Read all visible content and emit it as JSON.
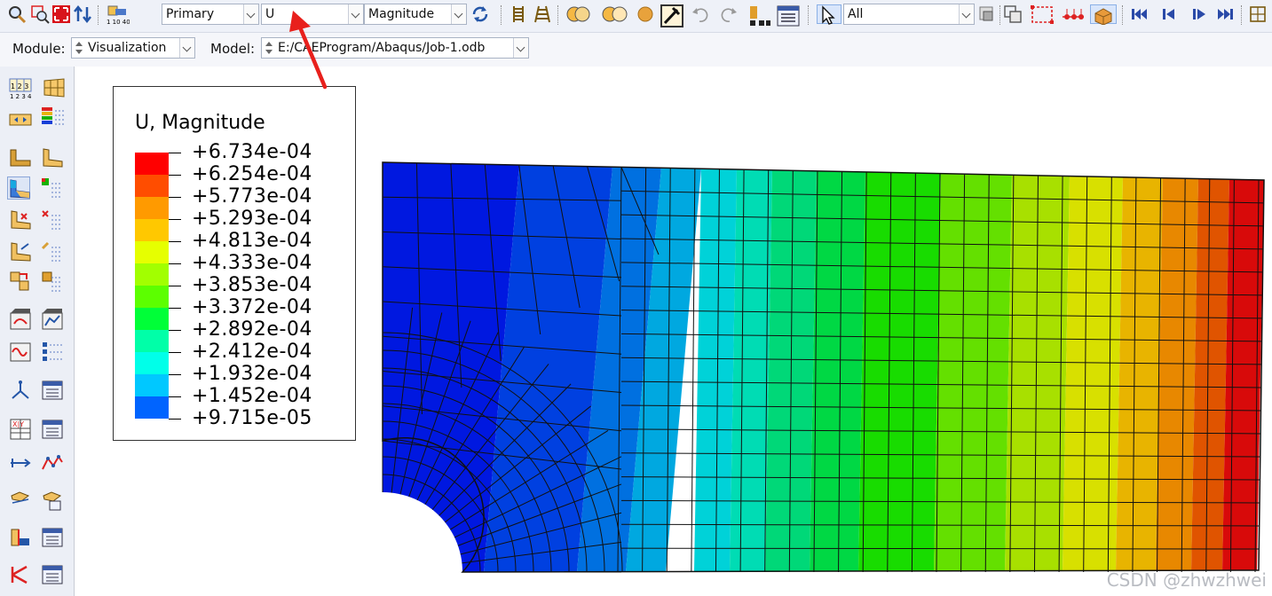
{
  "toolbar": {
    "field_output_type": "Primary",
    "field_variable": "U",
    "field_component": "Magnitude",
    "selection_filter": "All"
  },
  "module_row": {
    "module_label": "Module:",
    "module_value": "Visualization",
    "model_label": "Model:",
    "model_value": "E:/CAEProgram/Abaqus/Job-1.odb"
  },
  "legend": {
    "title": "U, Magnitude",
    "values": [
      "+6.734e-04",
      "+6.254e-04",
      "+5.773e-04",
      "+5.293e-04",
      "+4.813e-04",
      "+4.333e-04",
      "+3.853e-04",
      "+3.372e-04",
      "+2.892e-04",
      "+2.412e-04",
      "+1.932e-04",
      "+1.452e-04",
      "+9.715e-05"
    ],
    "colors": [
      "#ff0000",
      "#ff4d00",
      "#ff9a00",
      "#ffc800",
      "#e6ff00",
      "#a2ff00",
      "#5cff00",
      "#00ff38",
      "#00ffa8",
      "#00ffe9",
      "#00c8ff",
      "#0064ff",
      "#0018ff"
    ]
  },
  "contour_colors": [
    "#0018e0",
    "#0040e0",
    "#0070e0",
    "#00a8e0",
    "#00d2d8",
    "#00dcb4",
    "#00d878",
    "#00d844",
    "#18dc00",
    "#64e000",
    "#a8e000",
    "#d8e000",
    "#e8b400",
    "#e88800",
    "#e05400",
    "#d80a0a"
  ],
  "accent_colors": {
    "annotation_arrow": "#e8201c",
    "selection": "#3a6fd8"
  },
  "watermark": "CSDN @zhwzhwei"
}
